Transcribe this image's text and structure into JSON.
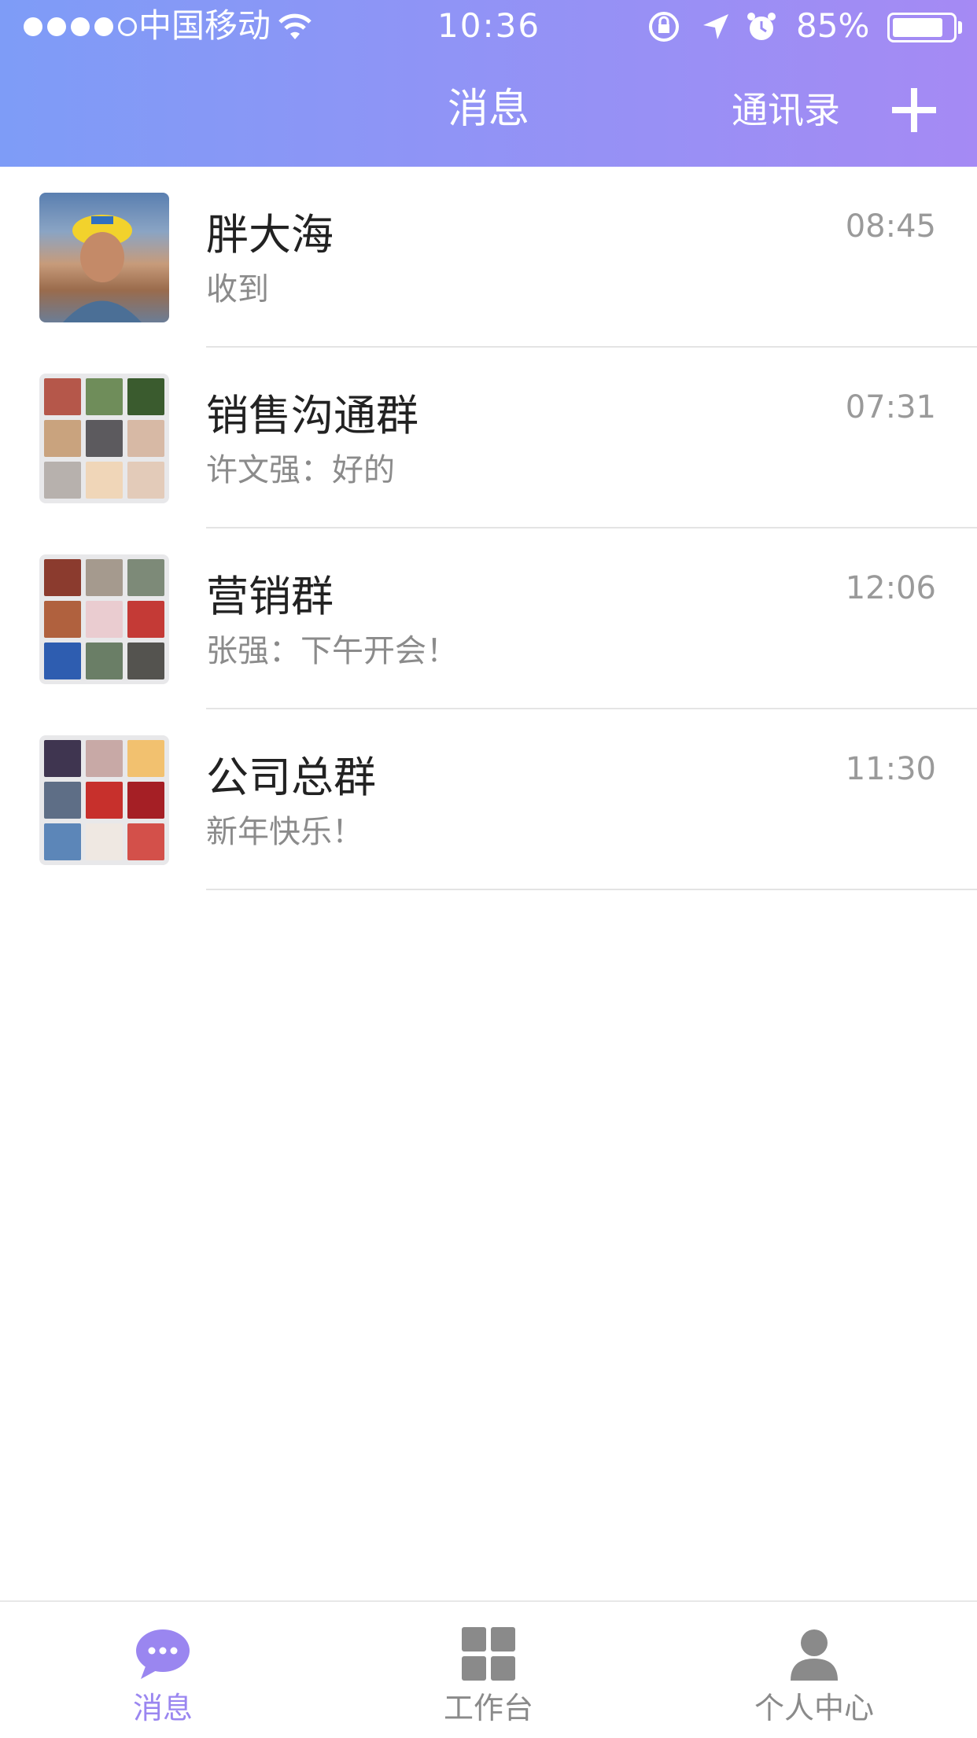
{
  "status_bar": {
    "carrier": "中国移动",
    "time": "10:36",
    "battery": "85%",
    "battery_level": 0.85
  },
  "header": {
    "title": "消息",
    "contacts_label": "通讯录",
    "add_icon": "plus-icon"
  },
  "conversations": [
    {
      "name": "胖大海",
      "message": "收到",
      "time": "08:45",
      "avatar": "single-photo"
    },
    {
      "name": "销售沟通群",
      "message": "许文强：好的",
      "time": "07:31",
      "avatar": "group-grid"
    },
    {
      "name": "营销群",
      "message": "张强：下午开会！",
      "time": "12:06",
      "avatar": "group-grid"
    },
    {
      "name": "公司总群",
      "message": "新年快乐！",
      "time": "11:30",
      "avatar": "group-grid"
    }
  ],
  "tabbar": {
    "tabs": [
      {
        "label": "消息",
        "icon": "chat-bubble-icon",
        "active": true
      },
      {
        "label": "工作台",
        "icon": "grid-icon",
        "active": false
      },
      {
        "label": "个人中心",
        "icon": "person-icon",
        "active": false
      }
    ]
  },
  "colors": {
    "header_gradient_start": "#7e9cf7",
    "header_gradient_end": "#a58af4",
    "active_tab": "#9a86f0"
  }
}
